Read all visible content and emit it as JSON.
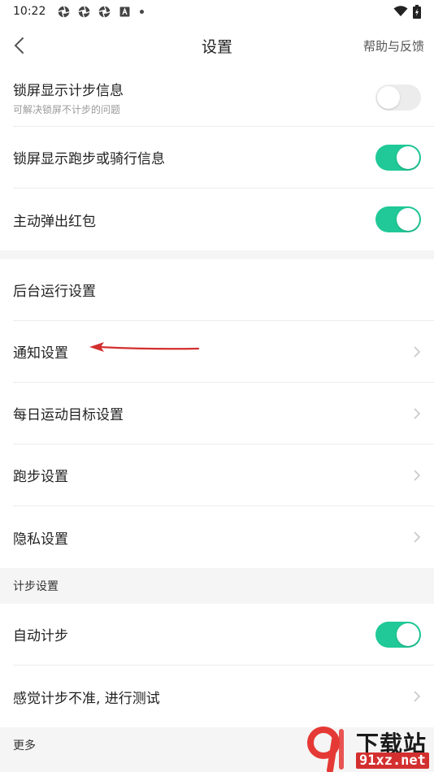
{
  "status_bar": {
    "time": "10:22",
    "icons_left": [
      "aperture-icon",
      "aperture-icon",
      "aperture-icon",
      "text-a-icon",
      "dot-icon"
    ],
    "icons_right": [
      "wifi-icon",
      "battery-charging-icon"
    ]
  },
  "header": {
    "title": "设置",
    "help_label": "帮助与反馈"
  },
  "group1": [
    {
      "label": "锁屏显示计步信息",
      "sub": "可解决锁屏不计步的问题",
      "toggle": false
    },
    {
      "label": "锁屏显示跑步或骑行信息",
      "toggle": true
    },
    {
      "label": "主动弹出红包",
      "toggle": true
    }
  ],
  "group2": [
    {
      "label": "后台运行设置"
    },
    {
      "label": "通知设置"
    },
    {
      "label": "每日运动目标设置"
    },
    {
      "label": "跑步设置"
    },
    {
      "label": "隐私设置"
    }
  ],
  "section_step": {
    "header": "计步设置",
    "items": [
      {
        "label": "自动计步",
        "toggle": true
      },
      {
        "label": "感觉计步不准, 进行测试"
      }
    ]
  },
  "section_more": {
    "header": "更多"
  },
  "watermark": {
    "cn": "下载站",
    "en": "91xz.net"
  },
  "colors": {
    "accent": "#20c997",
    "arrow": "#d32f2f"
  }
}
